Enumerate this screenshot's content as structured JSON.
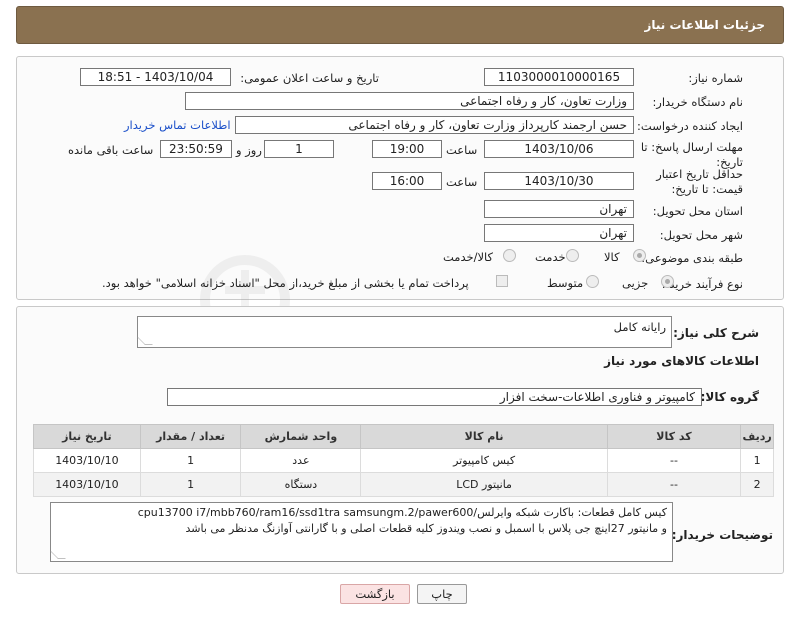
{
  "header": {
    "title": "جزئیات اطلاعات نیاز"
  },
  "form": {
    "need_number_label": "شماره نیاز:",
    "need_number": "1103000010000165",
    "announce_label": "تاریخ و ساعت اعلان عمومی:",
    "announce_value": "1403/10/04 - 18:51",
    "buyer_label": "نام دستگاه خریدار:",
    "buyer_value": "وزارت تعاون، کار و رفاه اجتماعی",
    "creator_label": "ایجاد کننده درخواست:",
    "creator_value": "حسن ارجمند کارپرداز وزارت تعاون، کار و رفاه اجتماعی",
    "contact_link": "اطلاعات تماس خریدار",
    "deadline_label": "مهلت ارسال پاسخ: تا تاریخ:",
    "deadline_date": "1403/10/06",
    "time_label": "ساعت",
    "deadline_time": "19:00",
    "days_value": "1",
    "days_label": "روز و",
    "remaining_time": "23:50:59",
    "remaining_label": "ساعت باقی مانده",
    "validity_label": "حداقل تاریخ اعتبار قیمت: تا تاریخ:",
    "validity_date": "1403/10/30",
    "validity_time_label": "ساعت",
    "validity_time": "16:00",
    "province_label": "استان محل تحویل:",
    "province_value": "تهران",
    "city_label": "شهر محل تحویل:",
    "city_value": "تهران",
    "category_label": "طبقه بندی موضوعی:",
    "category_options": [
      "کالا",
      "خدمت",
      "کالا/خدمت"
    ],
    "process_label": "نوع فرآیند خرید :",
    "process_options": [
      "جزیی",
      "متوسط"
    ],
    "payment_note": "پرداخت تمام یا بخشی از مبلغ خرید،از محل \"اسناد خزانه اسلامی\" خواهد بود."
  },
  "details": {
    "summary_label": "شرح کلی نیاز:",
    "summary_value": "رایانه کامل",
    "goods_info_title": "اطلاعات کالاهای مورد نیاز",
    "group_label": "گروه کالا:",
    "group_value": "کامپیوتر و فناوری اطلاعات-سخت افزار",
    "table": {
      "headers": [
        "ردیف",
        "کد کالا",
        "نام کالا",
        "واحد شمارش",
        "تعداد / مقدار",
        "تاریخ نیاز"
      ],
      "rows": [
        [
          "1",
          "--",
          "کیس کامپیوتر",
          "عدد",
          "1",
          "1403/10/10"
        ],
        [
          "2",
          "--",
          "مانیتور LCD",
          "دستگاه",
          "1",
          "1403/10/10"
        ]
      ]
    },
    "buyer_notes_label": "توضیحات خریدار:",
    "buyer_notes_line1": "کیس کامل قطعات: باکارت شبکه وایرلس/cpu13700 i7/mbb760/ram16/ssd1tra samsungm.2/pawer600",
    "buyer_notes_line2": "و مانیتور 27اینچ جی پلاس با اسمبل و نصب ویندوز کلیه قطعات اصلی و با گارانتی آوازنگ مدنظر می باشد"
  },
  "buttons": {
    "print": "چاپ",
    "back": "بازگشت"
  },
  "watermark": {
    "text": "AriaTender.net"
  },
  "colors": {
    "header": "#8a7150",
    "link": "#1a4fc9",
    "back_button": "#fbe3e3"
  }
}
